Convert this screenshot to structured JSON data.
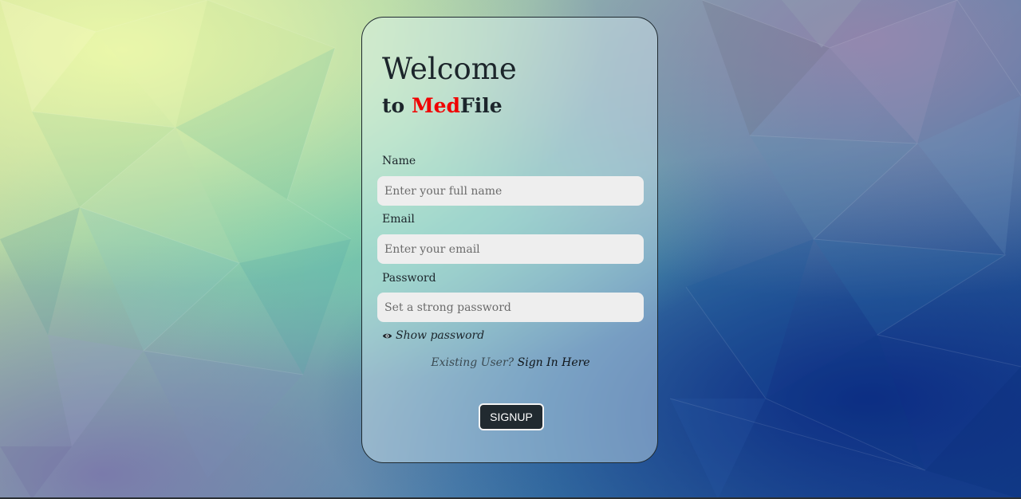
{
  "header": {
    "welcome": "Welcome",
    "subtitle_prefix": "to ",
    "brand_accent": "Med",
    "brand_rest": "File"
  },
  "form": {
    "name_label": "Name",
    "name_placeholder": "Enter your full name",
    "email_label": "Email",
    "email_placeholder": "Enter your email",
    "password_label": "Password",
    "password_placeholder": "Set a strong password",
    "show_password_label": "Show password",
    "existing_user_text": "Existing User?",
    "sign_in_link": "Sign In Here",
    "signup_label": "SIGNUP"
  },
  "icons": {
    "show_password": "eye-icon"
  },
  "colors": {
    "brand_accent": "#f00000",
    "button_bg": "#212a30",
    "input_bg": "#eeeeee"
  }
}
